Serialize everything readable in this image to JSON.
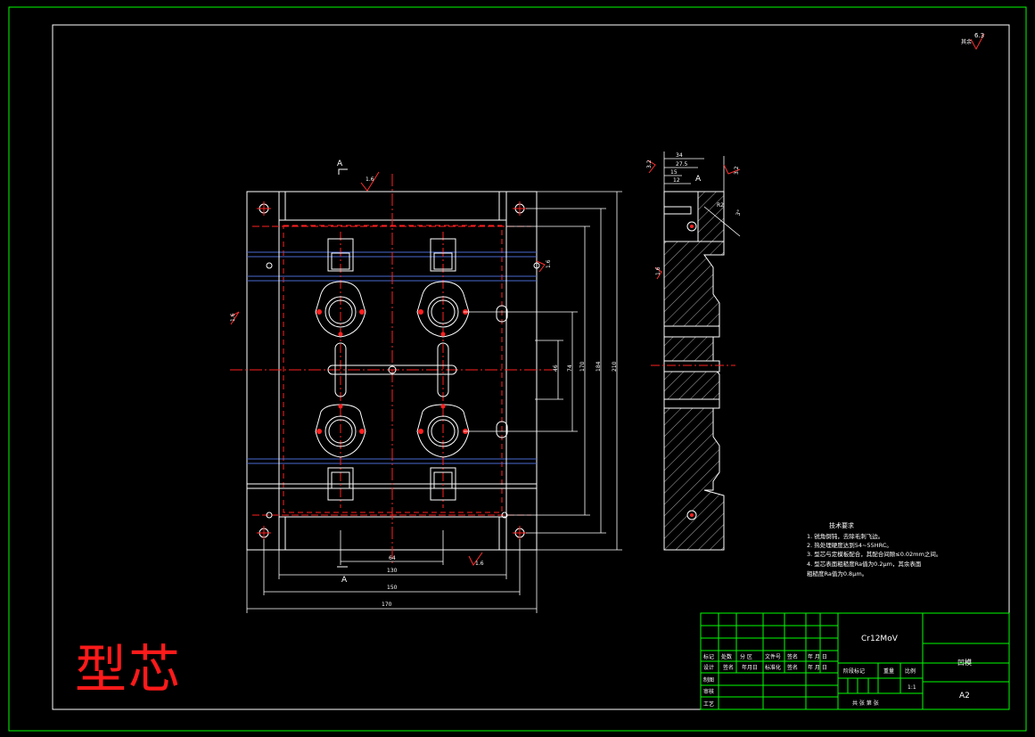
{
  "title_big": "型芯",
  "material": "Cr12MoV",
  "part_name": "凹模",
  "sheet_size": "A2",
  "scale": "1:1",
  "surface_roughness": {
    "corner": "6.3",
    "corner_note": "其余",
    "v1": "1.6",
    "v2": "1.6",
    "v3": "1.6",
    "v4": "1.6",
    "v5": "3.2",
    "v6": "3.2",
    "v7": "1.6"
  },
  "section_labels": {
    "top": "A",
    "bottom": "A",
    "side": "A"
  },
  "dimensions": {
    "bottom_1": "64",
    "bottom_2": "130",
    "bottom_3": "150",
    "bottom_4": "170",
    "right_1": "46",
    "right_2": "74",
    "right_3": "170",
    "right_4": "184",
    "right_5": "210",
    "side_top_1": "34",
    "side_top_2": "27.5",
    "side_top_3": "15",
    "side_top_4": "12",
    "side_angle": "3°",
    "side_r": "R2"
  },
  "tech_requirements": {
    "heading": "技术要求",
    "items": [
      "1. 锐角倒钝，去除毛刺飞边。",
      "2. 热处理硬度达到54~55HRC。",
      "3. 型芯与定模板配合，其配合间隙≤0.02mm之间。",
      "4. 型芯表面粗糙度Ra值为0.2μm，其余表面",
      "粗糙度Ra值为0.8μm。"
    ]
  },
  "title_block": {
    "row_labels_top": [
      "标记",
      "处数",
      "分 区",
      "文件号",
      "签名",
      "年 月 日"
    ],
    "row_labels_mid": [
      "设计",
      "",
      "签名",
      "年月日",
      "标准化",
      "签名",
      "年 月 日"
    ],
    "row_labels_left": [
      "制图",
      "审核",
      "工艺"
    ],
    "stage_mark": "阶段标记",
    "weight": "重量",
    "ratio": "比例",
    "sheet_info": "共  张 第  张"
  },
  "colors": {
    "frame": "#00ff00",
    "drawing": "#ffffff",
    "center": "#ff2020",
    "dim": "#ffffff",
    "hatch": "#cfcfcf"
  }
}
